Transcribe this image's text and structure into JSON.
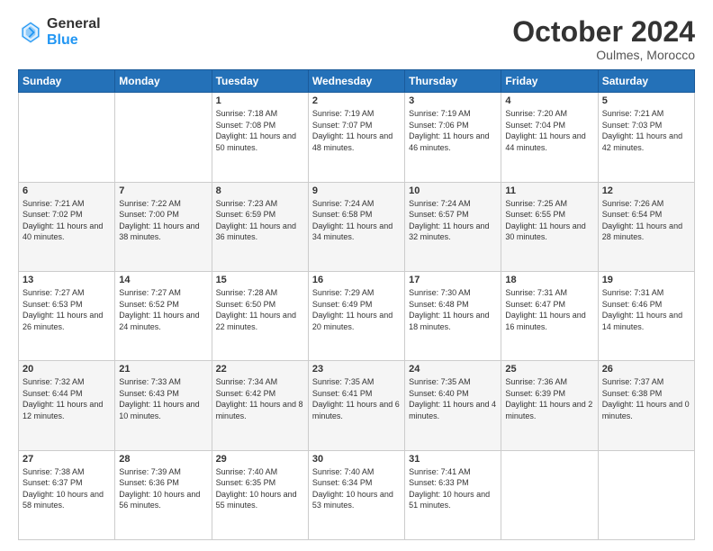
{
  "header": {
    "logo_line1": "General",
    "logo_line2": "Blue",
    "month": "October 2024",
    "location": "Oulmes, Morocco"
  },
  "days_of_week": [
    "Sunday",
    "Monday",
    "Tuesday",
    "Wednesday",
    "Thursday",
    "Friday",
    "Saturday"
  ],
  "weeks": [
    [
      {
        "day": "",
        "info": ""
      },
      {
        "day": "",
        "info": ""
      },
      {
        "day": "1",
        "info": "Sunrise: 7:18 AM\nSunset: 7:08 PM\nDaylight: 11 hours and 50 minutes."
      },
      {
        "day": "2",
        "info": "Sunrise: 7:19 AM\nSunset: 7:07 PM\nDaylight: 11 hours and 48 minutes."
      },
      {
        "day": "3",
        "info": "Sunrise: 7:19 AM\nSunset: 7:06 PM\nDaylight: 11 hours and 46 minutes."
      },
      {
        "day": "4",
        "info": "Sunrise: 7:20 AM\nSunset: 7:04 PM\nDaylight: 11 hours and 44 minutes."
      },
      {
        "day": "5",
        "info": "Sunrise: 7:21 AM\nSunset: 7:03 PM\nDaylight: 11 hours and 42 minutes."
      }
    ],
    [
      {
        "day": "6",
        "info": "Sunrise: 7:21 AM\nSunset: 7:02 PM\nDaylight: 11 hours and 40 minutes."
      },
      {
        "day": "7",
        "info": "Sunrise: 7:22 AM\nSunset: 7:00 PM\nDaylight: 11 hours and 38 minutes."
      },
      {
        "day": "8",
        "info": "Sunrise: 7:23 AM\nSunset: 6:59 PM\nDaylight: 11 hours and 36 minutes."
      },
      {
        "day": "9",
        "info": "Sunrise: 7:24 AM\nSunset: 6:58 PM\nDaylight: 11 hours and 34 minutes."
      },
      {
        "day": "10",
        "info": "Sunrise: 7:24 AM\nSunset: 6:57 PM\nDaylight: 11 hours and 32 minutes."
      },
      {
        "day": "11",
        "info": "Sunrise: 7:25 AM\nSunset: 6:55 PM\nDaylight: 11 hours and 30 minutes."
      },
      {
        "day": "12",
        "info": "Sunrise: 7:26 AM\nSunset: 6:54 PM\nDaylight: 11 hours and 28 minutes."
      }
    ],
    [
      {
        "day": "13",
        "info": "Sunrise: 7:27 AM\nSunset: 6:53 PM\nDaylight: 11 hours and 26 minutes."
      },
      {
        "day": "14",
        "info": "Sunrise: 7:27 AM\nSunset: 6:52 PM\nDaylight: 11 hours and 24 minutes."
      },
      {
        "day": "15",
        "info": "Sunrise: 7:28 AM\nSunset: 6:50 PM\nDaylight: 11 hours and 22 minutes."
      },
      {
        "day": "16",
        "info": "Sunrise: 7:29 AM\nSunset: 6:49 PM\nDaylight: 11 hours and 20 minutes."
      },
      {
        "day": "17",
        "info": "Sunrise: 7:30 AM\nSunset: 6:48 PM\nDaylight: 11 hours and 18 minutes."
      },
      {
        "day": "18",
        "info": "Sunrise: 7:31 AM\nSunset: 6:47 PM\nDaylight: 11 hours and 16 minutes."
      },
      {
        "day": "19",
        "info": "Sunrise: 7:31 AM\nSunset: 6:46 PM\nDaylight: 11 hours and 14 minutes."
      }
    ],
    [
      {
        "day": "20",
        "info": "Sunrise: 7:32 AM\nSunset: 6:44 PM\nDaylight: 11 hours and 12 minutes."
      },
      {
        "day": "21",
        "info": "Sunrise: 7:33 AM\nSunset: 6:43 PM\nDaylight: 11 hours and 10 minutes."
      },
      {
        "day": "22",
        "info": "Sunrise: 7:34 AM\nSunset: 6:42 PM\nDaylight: 11 hours and 8 minutes."
      },
      {
        "day": "23",
        "info": "Sunrise: 7:35 AM\nSunset: 6:41 PM\nDaylight: 11 hours and 6 minutes."
      },
      {
        "day": "24",
        "info": "Sunrise: 7:35 AM\nSunset: 6:40 PM\nDaylight: 11 hours and 4 minutes."
      },
      {
        "day": "25",
        "info": "Sunrise: 7:36 AM\nSunset: 6:39 PM\nDaylight: 11 hours and 2 minutes."
      },
      {
        "day": "26",
        "info": "Sunrise: 7:37 AM\nSunset: 6:38 PM\nDaylight: 11 hours and 0 minutes."
      }
    ],
    [
      {
        "day": "27",
        "info": "Sunrise: 7:38 AM\nSunset: 6:37 PM\nDaylight: 10 hours and 58 minutes."
      },
      {
        "day": "28",
        "info": "Sunrise: 7:39 AM\nSunset: 6:36 PM\nDaylight: 10 hours and 56 minutes."
      },
      {
        "day": "29",
        "info": "Sunrise: 7:40 AM\nSunset: 6:35 PM\nDaylight: 10 hours and 55 minutes."
      },
      {
        "day": "30",
        "info": "Sunrise: 7:40 AM\nSunset: 6:34 PM\nDaylight: 10 hours and 53 minutes."
      },
      {
        "day": "31",
        "info": "Sunrise: 7:41 AM\nSunset: 6:33 PM\nDaylight: 10 hours and 51 minutes."
      },
      {
        "day": "",
        "info": ""
      },
      {
        "day": "",
        "info": ""
      }
    ]
  ]
}
